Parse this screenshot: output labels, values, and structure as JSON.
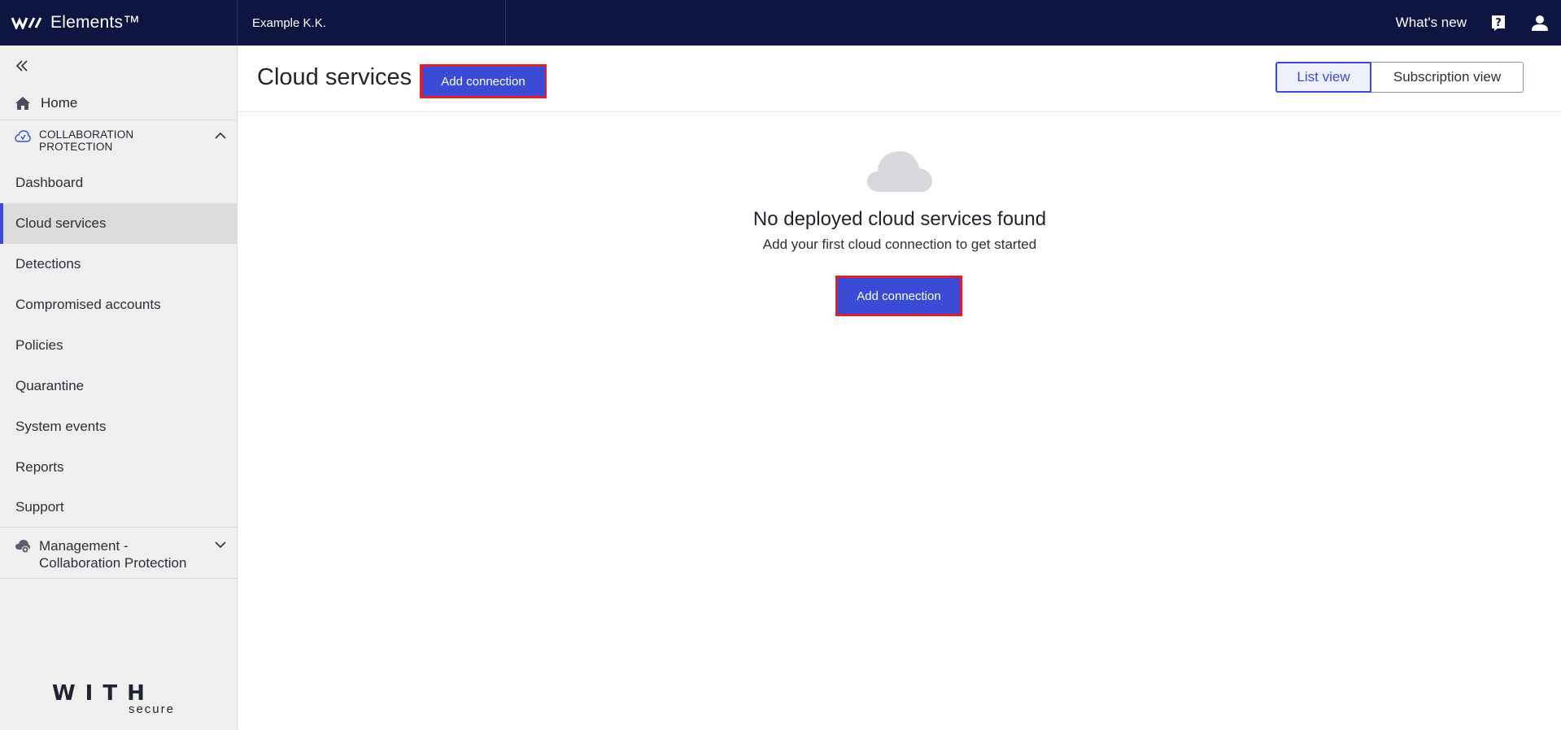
{
  "topbar": {
    "brand": "Elements™",
    "organization": "Example K.K.",
    "whats_new": "What's new"
  },
  "sidebar": {
    "home": "Home",
    "section_title": "COLLABORATION PROTECTION",
    "items": [
      {
        "label": "Dashboard"
      },
      {
        "label": "Cloud services",
        "active": true
      },
      {
        "label": "Detections"
      },
      {
        "label": "Compromised accounts"
      },
      {
        "label": "Policies"
      },
      {
        "label": "Quarantine"
      },
      {
        "label": "System events"
      },
      {
        "label": "Reports"
      },
      {
        "label": "Support"
      }
    ],
    "management": "Management - Collaboration Protection",
    "logo_word": "WITH",
    "logo_sub": "secure"
  },
  "main": {
    "title": "Cloud services",
    "add_connection": "Add connection",
    "views": {
      "list": "List view",
      "subscription": "Subscription view"
    },
    "empty_title": "No deployed cloud services found",
    "empty_subtitle": "Add your first cloud connection to get started",
    "empty_button": "Add connection"
  },
  "colors": {
    "topbar": "#0e1540",
    "accent": "#3a4bd6",
    "highlight": "#e01e2e"
  }
}
